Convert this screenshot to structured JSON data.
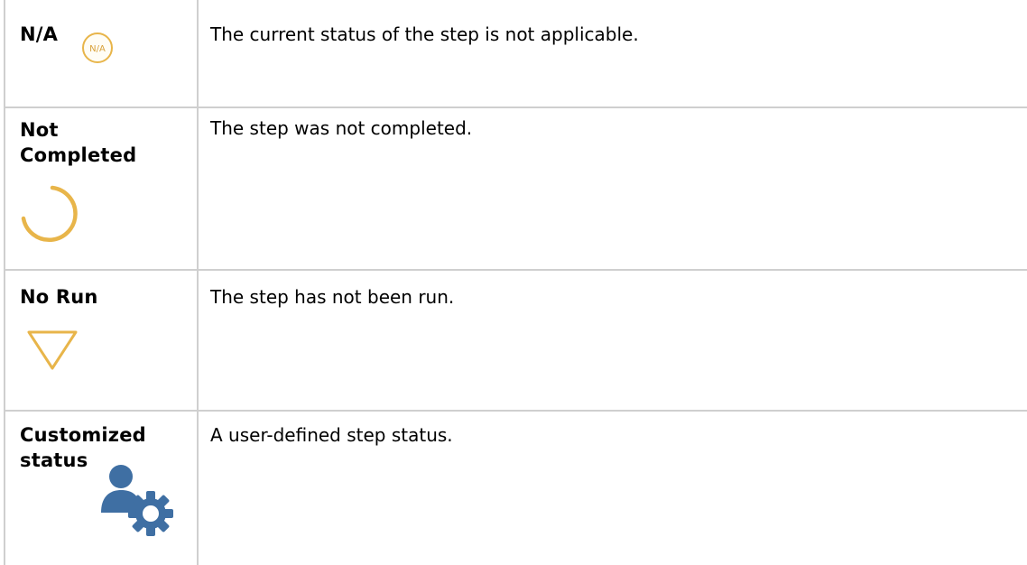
{
  "rows": [
    {
      "status": "N/A",
      "icon": "na-icon",
      "icon_text": "N/A",
      "description": "The current status of the step is not applicable."
    },
    {
      "status_line1": "Not",
      "status_line2": "Completed",
      "icon": "not-completed-arc-icon",
      "description": "The step was not completed."
    },
    {
      "status": "No Run",
      "icon": "no-run-triangle-icon",
      "description": "The step has not been run."
    },
    {
      "status_line1": "Customized",
      "status_line2": "status",
      "icon": "user-gear-icon",
      "description": "A user-defined step status."
    }
  ],
  "colors": {
    "status_gold": "#e8b54a",
    "custom_icon_blue": "#3f6fa3",
    "grid_line": "#cfcfcf"
  }
}
